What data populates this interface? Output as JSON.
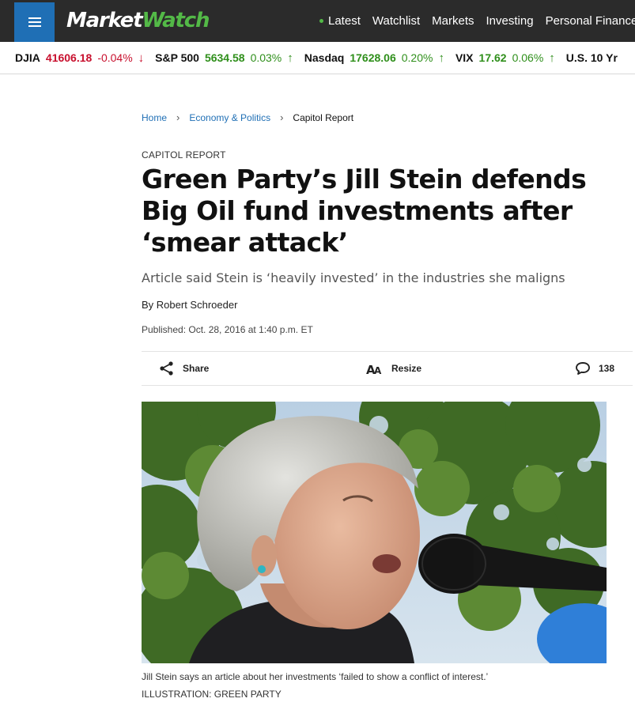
{
  "header": {
    "logo_part1": "Market",
    "logo_part2": "Watch",
    "nav": [
      "Latest",
      "Watchlist",
      "Markets",
      "Investing",
      "Personal Finance"
    ]
  },
  "ticker": [
    {
      "symbol": "DJIA",
      "value": "41606.18",
      "change": "-0.04%",
      "direction": "down"
    },
    {
      "symbol": "S&P 500",
      "value": "5634.58",
      "change": "0.03%",
      "direction": "up"
    },
    {
      "symbol": "Nasdaq",
      "value": "17628.06",
      "change": "0.20%",
      "direction": "up"
    },
    {
      "symbol": "VIX",
      "value": "17.62",
      "change": "0.06%",
      "direction": "up"
    },
    {
      "symbol": "U.S. 10 Yr",
      "value": "",
      "change": "",
      "direction": ""
    }
  ],
  "breadcrumb": {
    "home": "Home",
    "section": "Economy & Politics",
    "current": "Capitol Report"
  },
  "article": {
    "kicker": "CAPITOL REPORT",
    "headline": "Green Party’s Jill Stein defends Big Oil fund investments after ‘smear attack’",
    "subhead": "Article said Stein is ‘heavily invested’ in the industries she maligns",
    "byline_prefix": "By ",
    "author": "Robert Schroeder",
    "published": "Published: Oct. 28, 2016 at 1:40 p.m. ET"
  },
  "tools": {
    "share": "Share",
    "resize": "Resize",
    "comments": "138"
  },
  "image": {
    "caption": "Jill Stein says an article about her investments ‘failed to show a conflict of interest.’",
    "credit": "ILLUSTRATION: GREEN PARTY"
  },
  "colors": {
    "topbar": "#2b2b2b",
    "menu_button": "#1f6fb5",
    "brand_green": "#53b947",
    "negative": "#c8102e",
    "positive": "#2f8f1b",
    "link": "#1f6fb5"
  }
}
